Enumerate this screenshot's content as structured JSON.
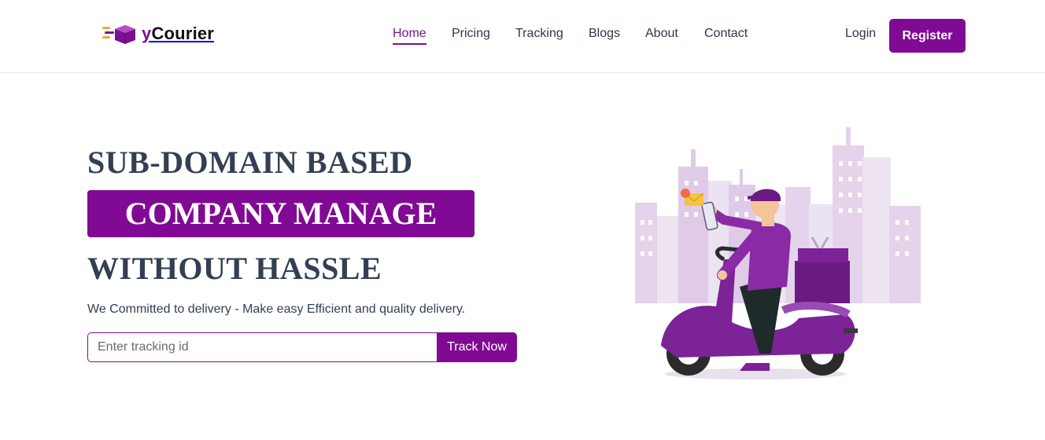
{
  "header": {
    "logo_prefix": "y",
    "logo_name": "Courier",
    "nav": [
      {
        "label": "Home",
        "active": true
      },
      {
        "label": "Pricing",
        "active": false
      },
      {
        "label": "Tracking",
        "active": false
      },
      {
        "label": "Blogs",
        "active": false
      },
      {
        "label": "About",
        "active": false
      },
      {
        "label": "Contact",
        "active": false
      }
    ],
    "login_label": "Login",
    "register_label": "Register"
  },
  "hero": {
    "line1": "SUB-DOMAIN BASED",
    "highlight": "COMPANY MANAGE",
    "line3": "WITHOUT HASSLE",
    "tagline": "We Committed to delivery - Make easy Efficient and quality delivery.",
    "tracking_placeholder": "Enter tracking id",
    "track_button": "Track Now"
  },
  "colors": {
    "brand": "#800a94",
    "heading": "#333f52"
  },
  "icons": [
    "delivery-box-logo-icon",
    "courier-scooter-illustration"
  ]
}
